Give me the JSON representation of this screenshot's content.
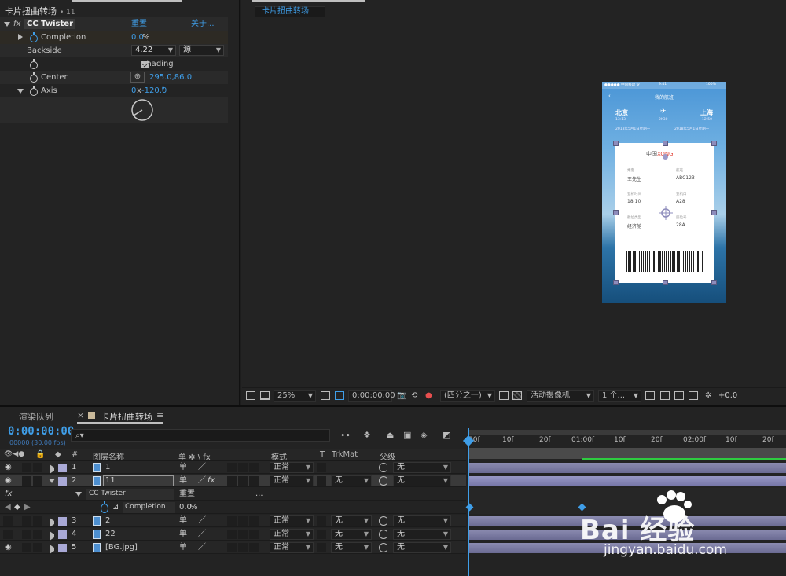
{
  "effect_controls": {
    "panel_title": "卡片扭曲转场",
    "panel_subtitle": "• 11",
    "effect_name": "CC Twister",
    "reset_label": "重置",
    "about_label": "关于...",
    "props": [
      {
        "name": "Completion",
        "value": "0.0",
        "unit": "%"
      },
      {
        "name": "Backside",
        "value": "4.22",
        "dropdown2": "源"
      },
      {
        "name": "Shading",
        "checked": true
      },
      {
        "name": "Center",
        "value": "295.0,86.0"
      },
      {
        "name": "Axis",
        "value_prefix": "0",
        "value_x": "x",
        "value": "-120.0",
        "unit": "°"
      }
    ]
  },
  "viewer": {
    "tab_label": "卡片扭曲转场",
    "phone": {
      "status_left": "●●●●● 中国移动 令",
      "status_time": "9:41",
      "status_right": "100%",
      "title": "我的航班",
      "from_city": "北京",
      "to_city": "上海",
      "from_time": "13:13",
      "duration": "2h30",
      "to_time": "12:50",
      "from_date": "2018年5月1日星期一",
      "to_date": "2018年5月1日星期一",
      "airline_a": "中国",
      "airline_b": "XONG",
      "fields": [
        {
          "label": "乘客",
          "value": "王先生"
        },
        {
          "label": "航班",
          "value": "ABC123"
        },
        {
          "label": "登机时间",
          "value": "18:10"
        },
        {
          "label": "登机口",
          "value": "A28"
        },
        {
          "label": "舱位类型",
          "value": "经济舱"
        },
        {
          "label": "座位号",
          "value": "28A"
        }
      ]
    },
    "toolbar": {
      "zoom": "25%",
      "timecode": "0:00:00:00",
      "resolution": "(四分之一)",
      "camera": "活动摄像机",
      "views": "1 个...",
      "exposure": "+0.0"
    }
  },
  "timeline": {
    "tabs": {
      "render_queue": "渲染队列",
      "close": "×",
      "comp": "卡片扭曲转场",
      "menu": "≡"
    },
    "timecode": "0:00:00:00",
    "fps": "00000 (30.00 fps)",
    "search_icon": "⌕▾",
    "columns": {
      "num": "#",
      "name": "图层名称",
      "switches": "单 ✲ \\ fx",
      "mode": "模式",
      "t": "T",
      "trkmat": "TrkMat",
      "parent": "父级"
    },
    "layers": [
      {
        "num": "1",
        "name": "1",
        "mode": "正常",
        "trkmat": "",
        "parent": "无"
      },
      {
        "num": "2",
        "name": "11",
        "mode": "正常",
        "trkmat": "无",
        "parent": "无"
      },
      {
        "num": "3",
        "name": "2",
        "mode": "正常",
        "trkmat": "无",
        "parent": "无"
      },
      {
        "num": "4",
        "name": "22",
        "mode": "正常",
        "trkmat": "无",
        "parent": "无"
      },
      {
        "num": "5",
        "name": "[BG.jpg]",
        "mode": "正常",
        "trkmat": "无",
        "parent": "无"
      }
    ],
    "effect_row": {
      "fx": "fx",
      "name": "CC Twister",
      "reset": "重置",
      "dots": "..."
    },
    "completion_row": {
      "name": "Completion",
      "value": "0.0",
      "unit": "%"
    },
    "switch_single": "单",
    "switch_slash": "／",
    "switch_fx": "fx",
    "ruler_labels": [
      "00f",
      "10f",
      "20f",
      "01:00f",
      "10f",
      "20f",
      "02:00f",
      "10f",
      "20f"
    ]
  },
  "watermark": {
    "text": "Bai 经验",
    "url": "jingyan.baidu.com"
  }
}
